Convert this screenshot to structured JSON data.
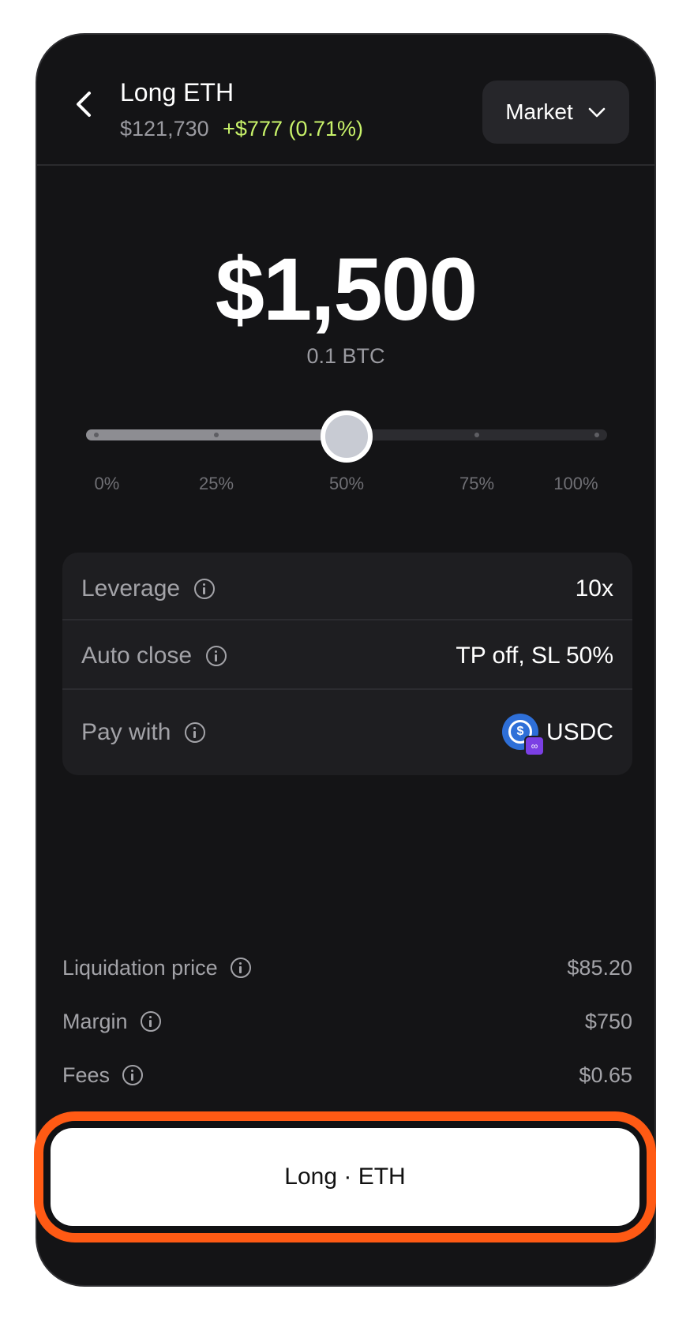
{
  "header": {
    "title": "Long ETH",
    "price": "$121,730",
    "change": "+$777 (0.71%)",
    "order_type": "Market"
  },
  "amount": {
    "value": "$1,500",
    "sub": "0.1 BTC"
  },
  "slider": {
    "value_percent": 50,
    "labels": [
      "0%",
      "25%",
      "50%",
      "75%",
      "100%"
    ]
  },
  "settings": {
    "rows": [
      {
        "label": "Leverage",
        "value": "10x"
      },
      {
        "label": "Auto close",
        "value": "TP off, SL 50%"
      },
      {
        "label": "Pay with",
        "value": "USDC"
      }
    ]
  },
  "summary": {
    "rows": [
      {
        "label": "Liquidation price",
        "value": "$85.20"
      },
      {
        "label": "Margin",
        "value": "$750"
      },
      {
        "label": "Fees",
        "value": "$0.65"
      }
    ]
  },
  "cta": {
    "label": "Long · ETH",
    "highlight_color": "#ff5a14"
  },
  "colors": {
    "positive": "#c9f36a",
    "background": "#141416"
  }
}
